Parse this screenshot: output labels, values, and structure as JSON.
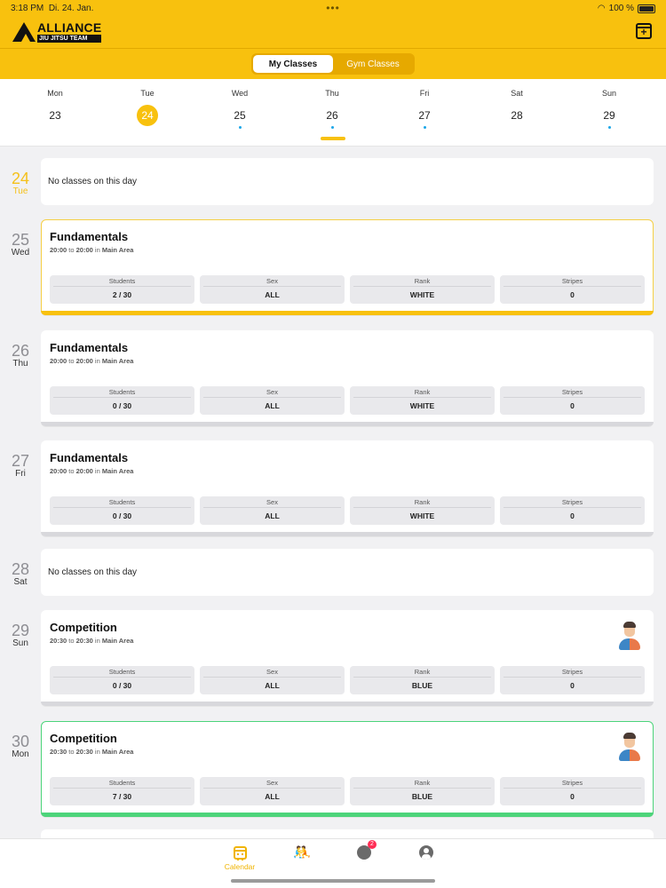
{
  "status_bar": {
    "time": "3:18 PM",
    "date": "Di. 24. Jan.",
    "battery": "100 %"
  },
  "brand": {
    "line1": "ALLIANCE",
    "line2": "JIU JITSU TEAM"
  },
  "header": {
    "add_icon": "calendar-plus-icon"
  },
  "segments": {
    "my_classes": "My Classes",
    "gym_classes": "Gym Classes"
  },
  "week": [
    {
      "dow": "Mon",
      "date": "23",
      "dot": false,
      "selected": false
    },
    {
      "dow": "Tue",
      "date": "24",
      "dot": false,
      "selected": true
    },
    {
      "dow": "Wed",
      "date": "25",
      "dot": true,
      "selected": false
    },
    {
      "dow": "Thu",
      "date": "26",
      "dot": true,
      "selected": false
    },
    {
      "dow": "Fri",
      "date": "27",
      "dot": true,
      "selected": false
    },
    {
      "dow": "Sat",
      "date": "28",
      "dot": false,
      "selected": false
    },
    {
      "dow": "Sun",
      "date": "29",
      "dot": true,
      "selected": false
    }
  ],
  "stat_labels": {
    "students": "Students",
    "sex": "Sex",
    "rank": "Rank",
    "stripes": "Stripes"
  },
  "time_words": {
    "to": "to",
    "in": "in"
  },
  "days": [
    {
      "num": "24",
      "dow": "Tue",
      "today": true,
      "empty_text": "No classes on this day"
    },
    {
      "num": "25",
      "dow": "Wed",
      "class": {
        "name": "Fundamentals",
        "start": "20:00",
        "end": "20:00",
        "area": "Main Area",
        "students": "2 / 30",
        "sex": "ALL",
        "rank": "WHITE",
        "stripes": "0",
        "accent": "yellow"
      }
    },
    {
      "num": "26",
      "dow": "Thu",
      "class": {
        "name": "Fundamentals",
        "start": "20:00",
        "end": "20:00",
        "area": "Main Area",
        "students": "0 / 30",
        "sex": "ALL",
        "rank": "WHITE",
        "stripes": "0",
        "accent": "none"
      }
    },
    {
      "num": "27",
      "dow": "Fri",
      "class": {
        "name": "Fundamentals",
        "start": "20:00",
        "end": "20:00",
        "area": "Main Area",
        "students": "0 / 30",
        "sex": "ALL",
        "rank": "WHITE",
        "stripes": "0",
        "accent": "none"
      }
    },
    {
      "num": "28",
      "dow": "Sat",
      "empty_text": "No classes on this day"
    },
    {
      "num": "29",
      "dow": "Sun",
      "class": {
        "name": "Competition",
        "start": "20:30",
        "end": "20:30",
        "area": "Main Area",
        "students": "0 / 30",
        "sex": "ALL",
        "rank": "BLUE",
        "stripes": "0",
        "accent": "none",
        "avatar": true
      }
    },
    {
      "num": "30",
      "dow": "Mon",
      "class": {
        "name": "Competition",
        "start": "20:30",
        "end": "20:30",
        "area": "Main Area",
        "students": "7 / 30",
        "sex": "ALL",
        "rank": "BLUE",
        "stripes": "0",
        "accent": "green",
        "avatar": true
      }
    }
  ],
  "tabs": [
    {
      "icon": "calendar-icon",
      "label": "Calendar"
    },
    {
      "icon": "sparring-icon",
      "label": ""
    },
    {
      "icon": "notifications-icon",
      "label": "",
      "badge": "2"
    },
    {
      "icon": "profile-icon",
      "label": ""
    }
  ],
  "colors": {
    "brand_yellow": "#f8c10e",
    "selected_accent": "#f5cf45",
    "joined_accent": "#4cd47a",
    "event_dot": "#1aa6e8",
    "badge": "#ff2d55"
  }
}
